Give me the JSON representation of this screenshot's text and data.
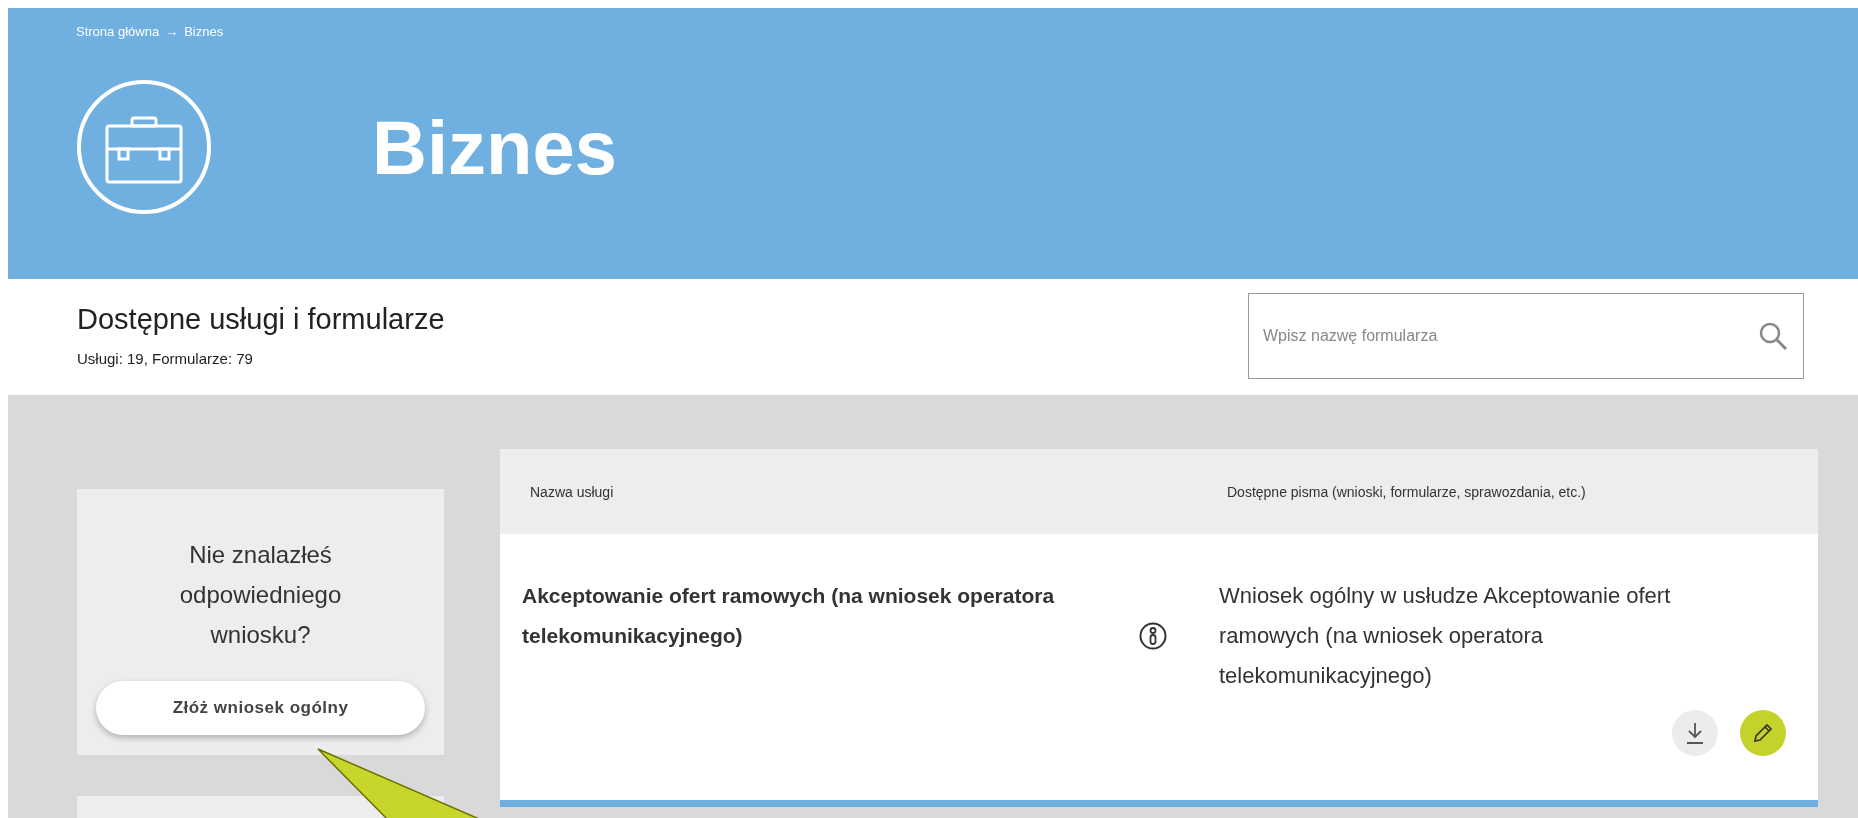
{
  "breadcrumb": {
    "items": [
      {
        "label": "Strona główna"
      },
      {
        "label": "Biznes"
      }
    ],
    "separator": "→"
  },
  "header": {
    "title": "Biznes"
  },
  "section": {
    "title": "Dostępne usługi i formularze",
    "counts": "Usługi: 19, Formularze: 79"
  },
  "search": {
    "placeholder": "Wpisz nazwę formularza"
  },
  "sidebar": {
    "question": "Nie znalazłeś odpowiedniego wniosku?",
    "button": "Złóż wniosek ogólny"
  },
  "table": {
    "columns": [
      "Nazwa usługi",
      "Dostępne pisma (wnioski, formularze, sprawozdania, etc.)"
    ],
    "rows": [
      {
        "service": "Akceptowanie ofert ramowych (na wniosek operatora telekomunikacyjnego)",
        "document": "Wniosek ogólny w usłudze Akceptowanie ofert ramowych (na wniosek operatora telekomunikacyjnego)"
      }
    ]
  }
}
